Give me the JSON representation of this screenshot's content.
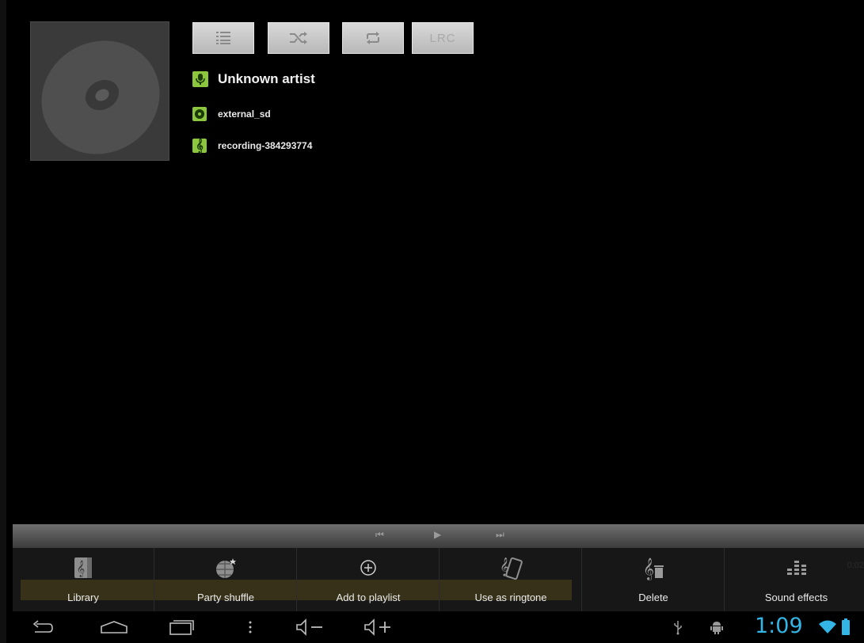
{
  "player": {
    "artist": "Unknown artist",
    "album": "external_sd",
    "track": "recording-384293774",
    "lrc_label": "LRC",
    "elapsed": "0:02"
  },
  "actions": [
    {
      "label": "Library",
      "icon": "library-icon"
    },
    {
      "label": "Party shuffle",
      "icon": "party-shuffle-icon"
    },
    {
      "label": "Add to playlist",
      "icon": "add-playlist-icon"
    },
    {
      "label": "Use as ringtone",
      "icon": "ringtone-icon"
    },
    {
      "label": "Delete",
      "icon": "delete-icon"
    },
    {
      "label": "Sound effects",
      "icon": "equalizer-icon"
    }
  ],
  "status": {
    "clock": "1:09"
  },
  "colors": {
    "accent_green": "#8cc63e",
    "clock_blue": "#33b5e5"
  }
}
